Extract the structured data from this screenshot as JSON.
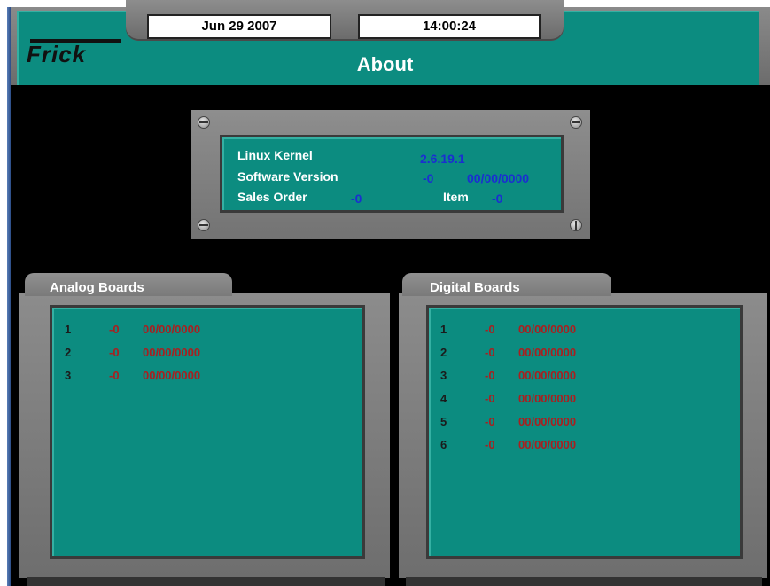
{
  "heading": "ABOUT",
  "header": {
    "date": "Jun 29 2007",
    "time": "14:00:24",
    "logo": "Frick",
    "title": "About"
  },
  "info": {
    "linux_kernel_label": "Linux Kernel",
    "linux_kernel_value": "2.6.19.1",
    "software_version_label": "Software Version",
    "software_version_value": "-0",
    "software_version_date": "00/00/0000",
    "sales_order_label": "Sales Order",
    "sales_order_value": "-0",
    "item_label": "Item",
    "item_value": "-0"
  },
  "analog": {
    "title": "Analog Boards",
    "rows": [
      {
        "num": "1",
        "rev": "-0",
        "date": "00/00/0000"
      },
      {
        "num": "2",
        "rev": "-0",
        "date": "00/00/0000"
      },
      {
        "num": "3",
        "rev": "-0",
        "date": "00/00/0000"
      }
    ]
  },
  "digital": {
    "title": "Digital Boards",
    "rows": [
      {
        "num": "1",
        "rev": "-0",
        "date": "00/00/0000"
      },
      {
        "num": "2",
        "rev": "-0",
        "date": "00/00/0000"
      },
      {
        "num": "3",
        "rev": "-0",
        "date": "00/00/0000"
      },
      {
        "num": "4",
        "rev": "-0",
        "date": "00/00/0000"
      },
      {
        "num": "5",
        "rev": "-0",
        "date": "00/00/0000"
      },
      {
        "num": "6",
        "rev": "-0",
        "date": "00/00/0000"
      }
    ]
  },
  "colors": {
    "screen_teal": "#0c8c80",
    "frame_gray": "#7e7e7e",
    "value_blue": "#1a2fd0",
    "value_red": "#a82020"
  }
}
